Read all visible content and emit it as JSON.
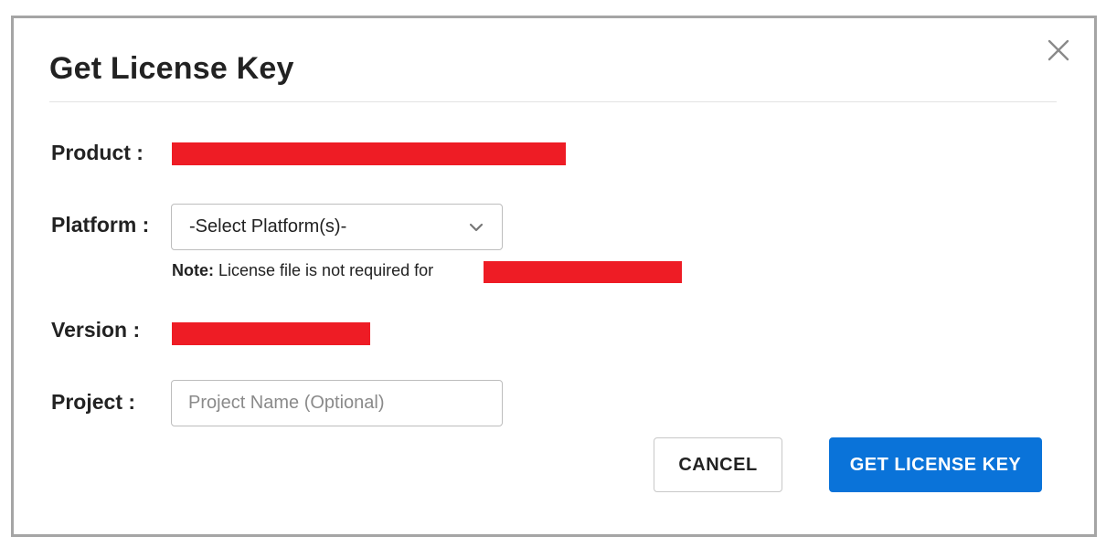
{
  "dialog": {
    "title": "Get License Key",
    "close_icon": "close-icon"
  },
  "fields": {
    "product_label": "Product :",
    "platform_label": "Platform :",
    "version_label": "Version :",
    "project_label": "Project :"
  },
  "platform_select": {
    "selected": "-Select Platform(s)-",
    "icon": "chevron-down-icon"
  },
  "note": {
    "prefix": "Note:",
    "text": " License file is not required for"
  },
  "project_input": {
    "value": "",
    "placeholder": "Project Name (Optional)"
  },
  "buttons": {
    "cancel": "CANCEL",
    "submit": "GET LICENSE KEY"
  },
  "colors": {
    "primary": "#0a73d9",
    "redaction": "#ee1c25",
    "text": "#222222"
  }
}
